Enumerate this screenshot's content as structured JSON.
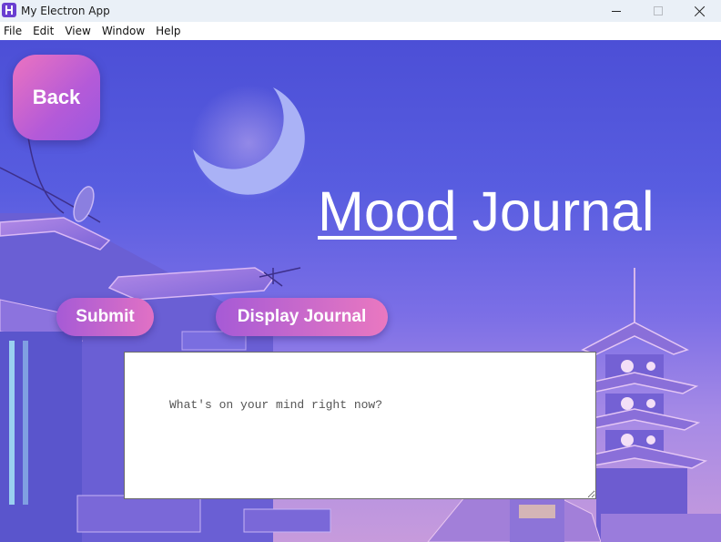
{
  "window": {
    "title": "My Electron App",
    "icon": "electron-app-icon"
  },
  "menu": {
    "items": [
      "File",
      "Edit",
      "View",
      "Window",
      "Help"
    ]
  },
  "page": {
    "back_label": "Back",
    "title_first": "Mood",
    "title_rest": " Journal",
    "submit_label": "Submit",
    "display_label": "Display Journal",
    "textarea_placeholder": "What's on your mind right now?",
    "textarea_value": ""
  },
  "colors": {
    "sky_top": "#4c4fd6",
    "sky_bottom": "#c79bdc",
    "button_pink": "#ec73c0",
    "button_purple": "#a65ad6",
    "moon": "#aab2f6"
  }
}
